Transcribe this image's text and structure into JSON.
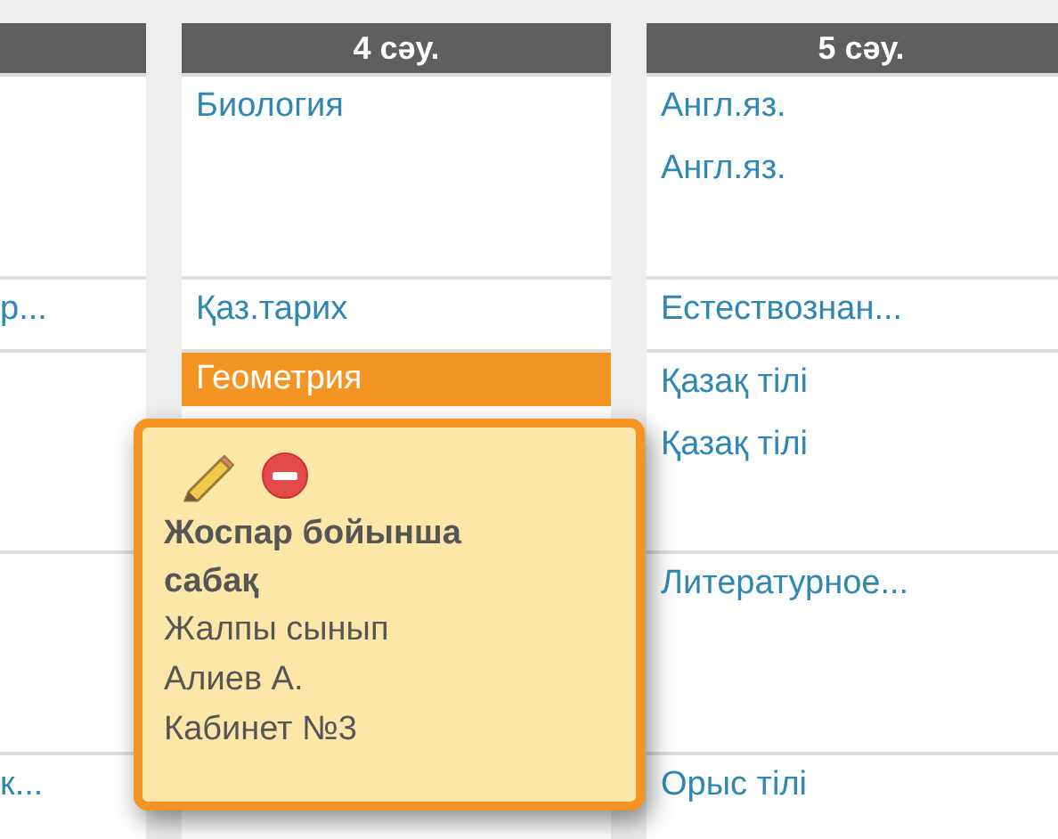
{
  "columns": [
    {
      "cells": [
        {},
        {
          "lessons": [
            {
              "name": "р...",
              "selected": false
            }
          ]
        },
        {},
        {},
        {
          "lessons": [
            {
              "name": "к...",
              "selected": false
            }
          ]
        }
      ]
    },
    {
      "header": "4 сәу.",
      "cells": [
        {
          "lessons": [
            {
              "name": "Биология",
              "selected": false
            }
          ]
        },
        {
          "lessons": [
            {
              "name": "Қаз.тарих",
              "selected": false
            }
          ]
        },
        {
          "lessons": [
            {
              "name": "Геометрия",
              "selected": true
            }
          ]
        },
        {},
        {}
      ]
    },
    {
      "header": "5 сәу.",
      "cells": [
        {
          "lessons": [
            {
              "name": "Англ.яз.",
              "selected": false
            },
            {
              "name": "Англ.яз.",
              "selected": false
            }
          ]
        },
        {
          "lessons": [
            {
              "name": "Естествознан...",
              "selected": false
            }
          ]
        },
        {
          "lessons": [
            {
              "name": "Қазақ тілі",
              "selected": false
            },
            {
              "name": "Қазақ тілі",
              "selected": false
            }
          ]
        },
        {
          "lessons": [
            {
              "name": "Литературное...",
              "selected": false
            }
          ]
        },
        {
          "lessons": [
            {
              "name": "Орыс тілі",
              "selected": false
            }
          ]
        }
      ]
    }
  ],
  "popup": {
    "title": "Жоспар бойынша сабақ",
    "lines": [
      "Жалпы сынып",
      "Алиев А.",
      "Кабинет №3"
    ]
  }
}
